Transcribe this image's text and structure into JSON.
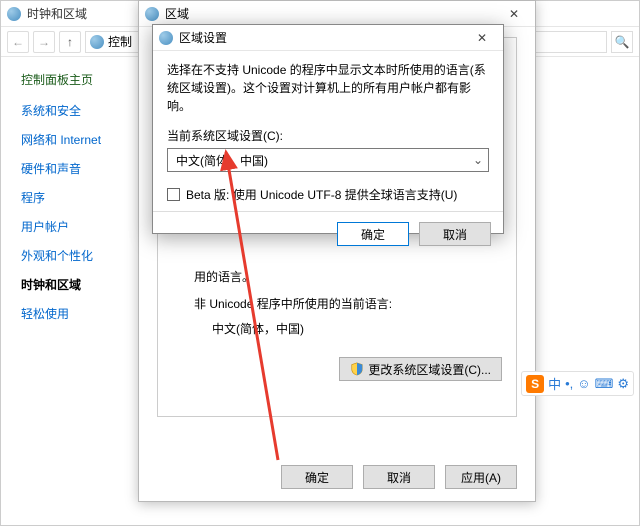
{
  "controlPanel": {
    "title": "时钟和区域",
    "crumb": "控制",
    "win控ls": {
      "min": "—",
      "max": "☐",
      "close": "✕"
    },
    "navBack": "←",
    "navFwd": "→",
    "navUp": "↑",
    "searchIcon": "🔍"
  },
  "sidebar": {
    "header": "控制面板主页",
    "items": [
      "系统和安全",
      "网络和 Internet",
      "硬件和声音",
      "程序",
      "用户帐户",
      "外观和个性化",
      "时钟和区域",
      "轻松使用"
    ],
    "currentIndex": 6
  },
  "regionDialog": {
    "title": "区域",
    "close": "✕",
    "contentHint1": "用的语言。",
    "contentHint2": "非 Unicode 程序中所使用的当前语言:",
    "currentLang": "中文(简体，中国)",
    "changeBtn": "更改系统区域设置(C)...",
    "okBtn": "确定",
    "cancelBtn": "取消",
    "applyBtn": "应用(A)"
  },
  "localeDialog": {
    "title": "区域设置",
    "close": "✕",
    "description": "选择在不支持 Unicode 的程序中显示文本时所使用的语言(系统区域设置)。这个设置对计算机上的所有用户帐户都有影响。",
    "selectLabel": "当前系统区域设置(C):",
    "selectValue": "中文(简体，中国)",
    "betaLabel": "Beta 版: 使用 Unicode UTF-8 提供全球语言支持(U)",
    "okBtn": "确定",
    "cancelBtn": "取消"
  },
  "ime": {
    "logo": "S",
    "items": [
      "中",
      "•,",
      "☺",
      "⌨",
      "⚙"
    ]
  }
}
